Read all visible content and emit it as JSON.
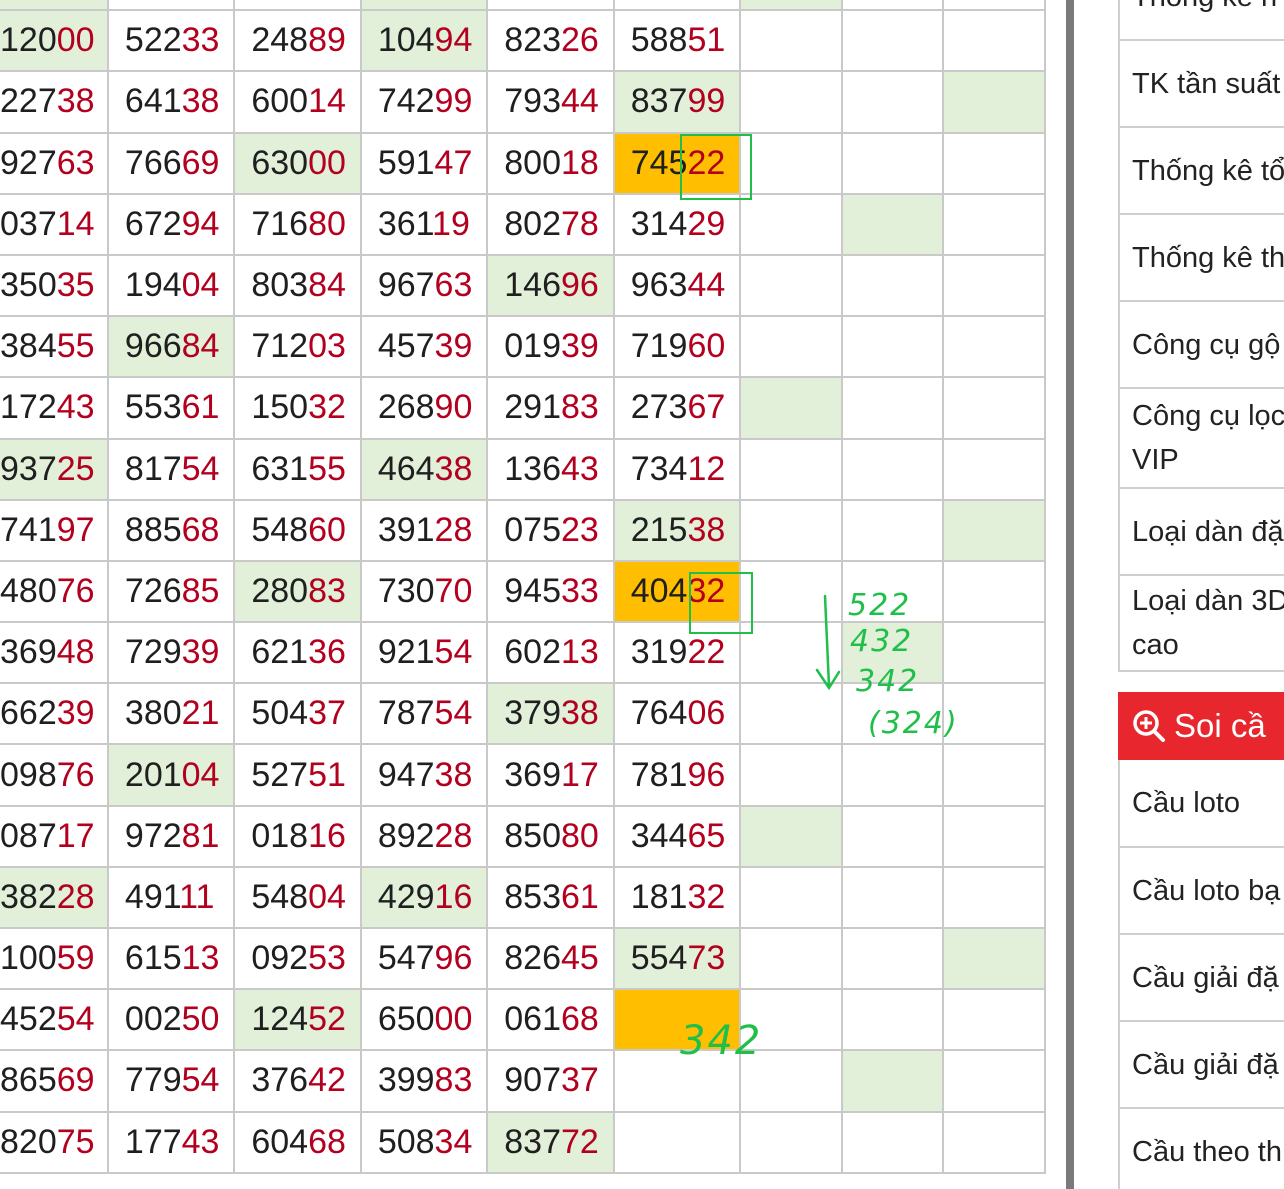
{
  "grid": {
    "rows": [
      {
        "cells": [
          {
            "v": "12000",
            "g": true
          },
          {
            "v": "52233"
          },
          {
            "v": "24889"
          },
          {
            "v": "10494",
            "g": true
          },
          {
            "v": "82326"
          },
          {
            "v": "58851"
          },
          {
            "v": ""
          },
          {
            "v": ""
          },
          {
            "v": ""
          }
        ]
      },
      {
        "cells": [
          {
            "v": "22738"
          },
          {
            "v": "64138"
          },
          {
            "v": "60014"
          },
          {
            "v": "74299"
          },
          {
            "v": "79344"
          },
          {
            "v": "83799",
            "g": true
          },
          {
            "v": ""
          },
          {
            "v": ""
          },
          {
            "v": "",
            "g": true
          }
        ]
      },
      {
        "cells": [
          {
            "v": "92763"
          },
          {
            "v": "76669"
          },
          {
            "v": "63000",
            "g": true
          },
          {
            "v": "59147"
          },
          {
            "v": "80018"
          },
          {
            "v": "74522",
            "o": true
          },
          {
            "v": ""
          },
          {
            "v": ""
          },
          {
            "v": ""
          }
        ]
      },
      {
        "cells": [
          {
            "v": "03714"
          },
          {
            "v": "67294"
          },
          {
            "v": "71680"
          },
          {
            "v": "36119"
          },
          {
            "v": "80278"
          },
          {
            "v": "31429"
          },
          {
            "v": ""
          },
          {
            "v": "",
            "g": true
          },
          {
            "v": ""
          }
        ]
      },
      {
        "cells": [
          {
            "v": "35035"
          },
          {
            "v": "19404"
          },
          {
            "v": "80384"
          },
          {
            "v": "96763"
          },
          {
            "v": "14696",
            "g": true
          },
          {
            "v": "96344"
          },
          {
            "v": ""
          },
          {
            "v": ""
          },
          {
            "v": ""
          }
        ]
      },
      {
        "cells": [
          {
            "v": "38455"
          },
          {
            "v": "96684",
            "g": true
          },
          {
            "v": "71203"
          },
          {
            "v": "45739"
          },
          {
            "v": "01939"
          },
          {
            "v": "71960"
          },
          {
            "v": ""
          },
          {
            "v": ""
          },
          {
            "v": ""
          }
        ]
      },
      {
        "cells": [
          {
            "v": "17243"
          },
          {
            "v": "55361"
          },
          {
            "v": "15032"
          },
          {
            "v": "26890"
          },
          {
            "v": "29183"
          },
          {
            "v": "27367"
          },
          {
            "v": "",
            "g": true
          },
          {
            "v": ""
          },
          {
            "v": ""
          }
        ]
      },
      {
        "cells": [
          {
            "v": "93725",
            "g": true
          },
          {
            "v": "81754"
          },
          {
            "v": "63155"
          },
          {
            "v": "46438",
            "g": true
          },
          {
            "v": "13643"
          },
          {
            "v": "73412"
          },
          {
            "v": ""
          },
          {
            "v": ""
          },
          {
            "v": ""
          }
        ]
      },
      {
        "cells": [
          {
            "v": "74197"
          },
          {
            "v": "88568"
          },
          {
            "v": "54860"
          },
          {
            "v": "39128"
          },
          {
            "v": "07523"
          },
          {
            "v": "21538",
            "g": true
          },
          {
            "v": ""
          },
          {
            "v": ""
          },
          {
            "v": "",
            "g": true
          }
        ]
      },
      {
        "cells": [
          {
            "v": "48076"
          },
          {
            "v": "72685"
          },
          {
            "v": "28083",
            "g": true
          },
          {
            "v": "73070"
          },
          {
            "v": "94533"
          },
          {
            "v": "40432",
            "o": true
          },
          {
            "v": ""
          },
          {
            "v": ""
          },
          {
            "v": ""
          }
        ]
      },
      {
        "cells": [
          {
            "v": "36948"
          },
          {
            "v": "72939"
          },
          {
            "v": "62136"
          },
          {
            "v": "92154"
          },
          {
            "v": "60213"
          },
          {
            "v": "31922"
          },
          {
            "v": ""
          },
          {
            "v": "",
            "g": true
          },
          {
            "v": ""
          }
        ]
      },
      {
        "cells": [
          {
            "v": "66239"
          },
          {
            "v": "38021"
          },
          {
            "v": "50437"
          },
          {
            "v": "78754"
          },
          {
            "v": "37938",
            "g": true
          },
          {
            "v": "76406"
          },
          {
            "v": ""
          },
          {
            "v": ""
          },
          {
            "v": ""
          }
        ]
      },
      {
        "cells": [
          {
            "v": "09876"
          },
          {
            "v": "20104",
            "g": true
          },
          {
            "v": "52751"
          },
          {
            "v": "94738"
          },
          {
            "v": "36917"
          },
          {
            "v": "78196"
          },
          {
            "v": ""
          },
          {
            "v": ""
          },
          {
            "v": ""
          }
        ]
      },
      {
        "cells": [
          {
            "v": "08717"
          },
          {
            "v": "97281"
          },
          {
            "v": "01816"
          },
          {
            "v": "89228"
          },
          {
            "v": "85080"
          },
          {
            "v": "34465"
          },
          {
            "v": "",
            "g": true
          },
          {
            "v": ""
          },
          {
            "v": ""
          }
        ]
      },
      {
        "cells": [
          {
            "v": "38228",
            "g": true
          },
          {
            "v": "49111"
          },
          {
            "v": "54804"
          },
          {
            "v": "42916",
            "g": true
          },
          {
            "v": "85361"
          },
          {
            "v": "18132"
          },
          {
            "v": ""
          },
          {
            "v": ""
          },
          {
            "v": ""
          }
        ]
      },
      {
        "cells": [
          {
            "v": "10059"
          },
          {
            "v": "61513"
          },
          {
            "v": "09253"
          },
          {
            "v": "54796"
          },
          {
            "v": "82645"
          },
          {
            "v": "55473",
            "g": true
          },
          {
            "v": ""
          },
          {
            "v": ""
          },
          {
            "v": "",
            "g": true
          }
        ]
      },
      {
        "cells": [
          {
            "v": "45254"
          },
          {
            "v": "00250"
          },
          {
            "v": "12452",
            "g": true
          },
          {
            "v": "65000"
          },
          {
            "v": "06168"
          },
          {
            "v": "",
            "o": true
          },
          {
            "v": ""
          },
          {
            "v": ""
          },
          {
            "v": ""
          }
        ]
      },
      {
        "cells": [
          {
            "v": "86569"
          },
          {
            "v": "77954"
          },
          {
            "v": "37642"
          },
          {
            "v": "39983"
          },
          {
            "v": "90737"
          },
          {
            "v": ""
          },
          {
            "v": ""
          },
          {
            "v": "",
            "g": true
          },
          {
            "v": ""
          }
        ]
      },
      {
        "cells": [
          {
            "v": "82075"
          },
          {
            "v": "17743"
          },
          {
            "v": "60468"
          },
          {
            "v": "50834"
          },
          {
            "v": "83772",
            "g": true
          },
          {
            "v": ""
          },
          {
            "v": ""
          },
          {
            "v": ""
          },
          {
            "v": ""
          }
        ]
      }
    ],
    "top_partial_green": [
      true,
      false,
      false,
      true,
      false,
      false,
      true,
      false,
      false
    ]
  },
  "annotations": {
    "note_line1": "522",
    "note_line2": "432",
    "note_line3": "342",
    "note_line4": "(324)",
    "cell_note": "342",
    "color": "#1fbf4a"
  },
  "sidebar": {
    "stat_items": [
      {
        "label": "Thống kê n"
      },
      {
        "label": "TK tần suất"
      },
      {
        "label": "Thống kê tổ"
      },
      {
        "label": "Thống kê th"
      },
      {
        "label": "Công cụ gộ"
      },
      {
        "label": "Công cụ lọc",
        "label2": "VIP"
      },
      {
        "label": "Loại dàn đặ"
      },
      {
        "label": "Loại dàn 3D",
        "label2": "cao"
      }
    ],
    "soi_header": "Soi cầ",
    "soi_icon": "zoom-in-icon",
    "soi_items": [
      {
        "label": "Cầu loto"
      },
      {
        "label": "Cầu loto bạ"
      },
      {
        "label": "Cầu giải đặ"
      },
      {
        "label": "Cầu giải đặ"
      },
      {
        "label": "Cầu theo th"
      }
    ]
  },
  "colors": {
    "highlight_digit": "#b3001f",
    "green_cell": "#e2f0d9",
    "orange_cell": "#ffbf00",
    "header_red": "#e8262e"
  }
}
